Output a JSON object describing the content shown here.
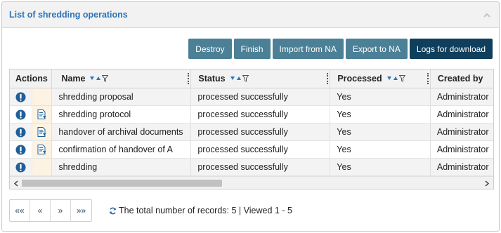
{
  "panel": {
    "title": "List of shredding operations"
  },
  "toolbar": {
    "destroy": "Destroy",
    "finish": "Finish",
    "import": "Import from NA",
    "export": "Export to NA",
    "logs": "Logs for download"
  },
  "grid": {
    "columns": {
      "actions": "Actions",
      "name": "Name",
      "status": "Status",
      "processed": "Processed",
      "created_by": "Created by"
    },
    "rows": [
      {
        "name": "shredding proposal",
        "status": "processed successfully",
        "processed": "Yes",
        "created_by": "Administrator",
        "has_doc": false
      },
      {
        "name": "shredding protocol",
        "status": "processed successfully",
        "processed": "Yes",
        "created_by": "Administrator",
        "has_doc": true
      },
      {
        "name": "handover of archival documents",
        "status": "processed successfully",
        "processed": "Yes",
        "created_by": "Administrator",
        "has_doc": true
      },
      {
        "name": "confirmation of handover of A",
        "status": "processed successfully",
        "processed": "Yes",
        "created_by": "Administrator",
        "has_doc": true
      },
      {
        "name": "shredding",
        "status": "processed successfully",
        "processed": "Yes",
        "created_by": "Administrator",
        "has_doc": false
      }
    ]
  },
  "pager": {
    "first": "««",
    "prev": "«",
    "next": "»",
    "last": "»»"
  },
  "records": {
    "text": "The total number of records: 5 | Viewed 1 - 5"
  },
  "colors": {
    "title": "#2b74b8",
    "button": "#4c8096",
    "button_primary": "#0f3f5c",
    "info_icon": "#1f5f99"
  }
}
